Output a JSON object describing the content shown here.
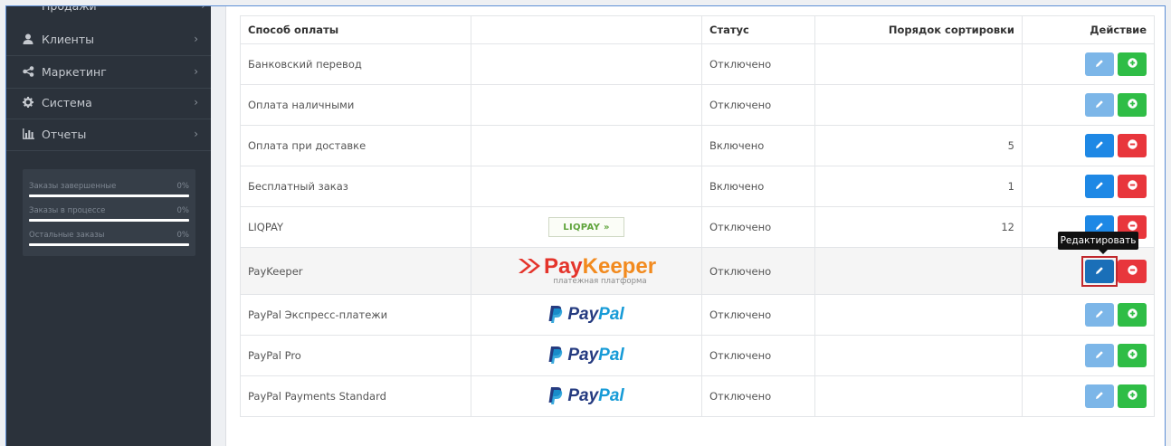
{
  "sidebar": {
    "partial_item": "Продажи",
    "items": [
      {
        "label": "Клиенты",
        "icon": "user-icon"
      },
      {
        "label": "Маркетинг",
        "icon": "share-icon"
      },
      {
        "label": "Система",
        "icon": "gear-icon"
      },
      {
        "label": "Отчеты",
        "icon": "bar-chart-icon"
      }
    ],
    "stats": [
      {
        "label": "Заказы завершенные",
        "value": "0%",
        "percent": 100
      },
      {
        "label": "Заказы в процессе",
        "value": "0%",
        "percent": 100
      },
      {
        "label": "Остальные заказы",
        "value": "0%",
        "percent": 100
      }
    ]
  },
  "table": {
    "headers": {
      "method": "Способ оплаты",
      "logo": "",
      "status": "Статус",
      "sort": "Порядок сортировки",
      "action": "Действие"
    },
    "rows": [
      {
        "name": "Банковский перевод",
        "status": "Отключено",
        "sort": "",
        "logo": ""
      },
      {
        "name": "Оплата наличными",
        "status": "Отключено",
        "sort": "",
        "logo": ""
      },
      {
        "name": "Оплата при доставке",
        "status": "Включено",
        "sort": "5",
        "logo": ""
      },
      {
        "name": "Бесплатный заказ",
        "status": "Включено",
        "sort": "1",
        "logo": ""
      },
      {
        "name": "LIQPAY",
        "status": "Отключено",
        "sort": "12",
        "logo": "liqpay"
      },
      {
        "name": "PayKeeper",
        "status": "Отключено",
        "sort": "",
        "logo": "paykeeper"
      },
      {
        "name": "PayPal Экспресс-платежи",
        "status": "Отключено",
        "sort": "",
        "logo": "paypal"
      },
      {
        "name": "PayPal Pro",
        "status": "Отключено",
        "sort": "",
        "logo": "paypal"
      },
      {
        "name": "PayPal Payments Standard",
        "status": "Отключено",
        "sort": "",
        "logo": "paypal"
      }
    ]
  },
  "logos": {
    "liqpay_text": "LIQPAY",
    "liqpay_arrows": "»",
    "paykeeper_pay": "Pay",
    "paykeeper_keeper": "Keeper",
    "paykeeper_sub": "платежная платформа",
    "paypal_a": "Pay",
    "paypal_b": "Pal"
  },
  "tooltip": "Редактировать",
  "colors": {
    "sidebar_bg": "#2b323b",
    "edit_button": "#1e88e5",
    "install_button": "#2fbd46",
    "uninstall_button": "#e8363c",
    "highlight_outline": "#c0282d"
  }
}
